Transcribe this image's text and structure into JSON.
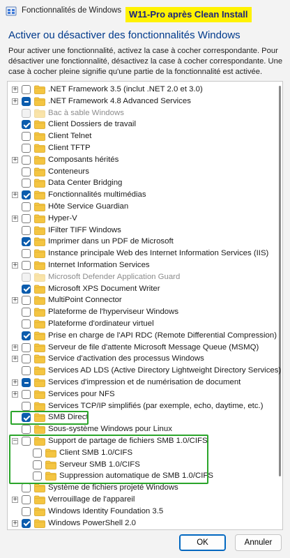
{
  "window": {
    "title": "Fonctionnalités de Windows",
    "annotation": "W11-Pro après Clean Install"
  },
  "heading": "Activer ou désactiver des fonctionnalités Windows",
  "description": "Pour activer une fonctionnalité, activez la case à cocher correspondante. Pour désactiver une fonctionnalité, désactivez la case à cocher correspondante. Une case à cocher pleine signifie qu'une partie de la fonctionnalité est activée.",
  "features": [
    {
      "label": ".NET Framework 3.5 (inclut .NET 2.0 et 3.0)",
      "state": "unchecked",
      "expandable": true,
      "level": 0
    },
    {
      "label": ".NET Framework 4.8 Advanced Services",
      "state": "partial",
      "expandable": true,
      "level": 0
    },
    {
      "label": "Bac à sable Windows",
      "state": "disabled",
      "expandable": false,
      "level": 0
    },
    {
      "label": "Client Dossiers de travail",
      "state": "checked",
      "expandable": false,
      "level": 0
    },
    {
      "label": "Client Telnet",
      "state": "unchecked",
      "expandable": false,
      "level": 0
    },
    {
      "label": "Client TFTP",
      "state": "unchecked",
      "expandable": false,
      "level": 0
    },
    {
      "label": "Composants hérités",
      "state": "unchecked",
      "expandable": true,
      "level": 0
    },
    {
      "label": "Conteneurs",
      "state": "unchecked",
      "expandable": false,
      "level": 0
    },
    {
      "label": "Data Center Bridging",
      "state": "unchecked",
      "expandable": false,
      "level": 0
    },
    {
      "label": "Fonctionnalités multimédias",
      "state": "checked",
      "expandable": true,
      "level": 0
    },
    {
      "label": "Hôte Service Guardian",
      "state": "unchecked",
      "expandable": false,
      "level": 0
    },
    {
      "label": "Hyper-V",
      "state": "unchecked",
      "expandable": true,
      "level": 0
    },
    {
      "label": "IFilter TIFF Windows",
      "state": "unchecked",
      "expandable": false,
      "level": 0
    },
    {
      "label": "Imprimer dans un PDF de Microsoft",
      "state": "checked",
      "expandable": false,
      "level": 0
    },
    {
      "label": "Instance principale Web des Internet Information Services (IIS)",
      "state": "unchecked",
      "expandable": false,
      "level": 0
    },
    {
      "label": "Internet Information Services",
      "state": "unchecked",
      "expandable": true,
      "level": 0
    },
    {
      "label": "Microsoft Defender Application Guard",
      "state": "disabled",
      "expandable": false,
      "level": 0
    },
    {
      "label": "Microsoft XPS Document Writer",
      "state": "checked",
      "expandable": false,
      "level": 0
    },
    {
      "label": "MultiPoint Connector",
      "state": "unchecked",
      "expandable": true,
      "level": 0
    },
    {
      "label": "Plateforme de l'hyperviseur Windows",
      "state": "unchecked",
      "expandable": false,
      "level": 0
    },
    {
      "label": "Plateforme d'ordinateur virtuel",
      "state": "unchecked",
      "expandable": false,
      "level": 0
    },
    {
      "label": "Prise en charge de l'API RDC (Remote Differential Compression)",
      "state": "checked",
      "expandable": false,
      "level": 0
    },
    {
      "label": "Serveur de file d'attente Microsoft Message Queue (MSMQ)",
      "state": "unchecked",
      "expandable": true,
      "level": 0
    },
    {
      "label": "Service d'activation des processus Windows",
      "state": "unchecked",
      "expandable": true,
      "level": 0
    },
    {
      "label": "Services AD LDS (Active Directory Lightweight Directory Services)",
      "state": "unchecked",
      "expandable": false,
      "level": 0
    },
    {
      "label": "Services d'impression et de numérisation de document",
      "state": "partial",
      "expandable": true,
      "level": 0
    },
    {
      "label": "Services pour NFS",
      "state": "unchecked",
      "expandable": true,
      "level": 0
    },
    {
      "label": "Services TCP/IP simplifiés (par exemple, echo, daytime, etc.)",
      "state": "unchecked",
      "expandable": false,
      "level": 0
    },
    {
      "label": "SMB Direct",
      "state": "checked",
      "expandable": false,
      "level": 0
    },
    {
      "label": "Sous-système Windows pour Linux",
      "state": "unchecked",
      "expandable": false,
      "level": 0
    },
    {
      "label": "Support de partage de fichiers SMB 1.0/CIFS",
      "state": "unchecked",
      "expandable": true,
      "expanded": true,
      "level": 0
    },
    {
      "label": "Client SMB 1.0/CIFS",
      "state": "unchecked",
      "expandable": false,
      "level": 1
    },
    {
      "label": "Serveur SMB 1.0/CIFS",
      "state": "unchecked",
      "expandable": false,
      "level": 1
    },
    {
      "label": "Suppression automatique de SMB 1.0/CIFS",
      "state": "unchecked",
      "expandable": false,
      "level": 1
    },
    {
      "label": "Système de fichiers projeté Windows",
      "state": "unchecked",
      "expandable": false,
      "level": 0
    },
    {
      "label": "Verrouillage de l'appareil",
      "state": "unchecked",
      "expandable": true,
      "level": 0
    },
    {
      "label": "Windows Identity Foundation 3.5",
      "state": "unchecked",
      "expandable": false,
      "level": 0
    },
    {
      "label": "Windows PowerShell 2.0",
      "state": "checked",
      "expandable": true,
      "level": 0
    }
  ],
  "buttons": {
    "ok": "OK",
    "cancel": "Annuler"
  },
  "colors": {
    "accent": "#0b5cad",
    "highlight_box": "#2aa52a",
    "annotation_bg": "#fff200",
    "folder": "#f4c542"
  }
}
